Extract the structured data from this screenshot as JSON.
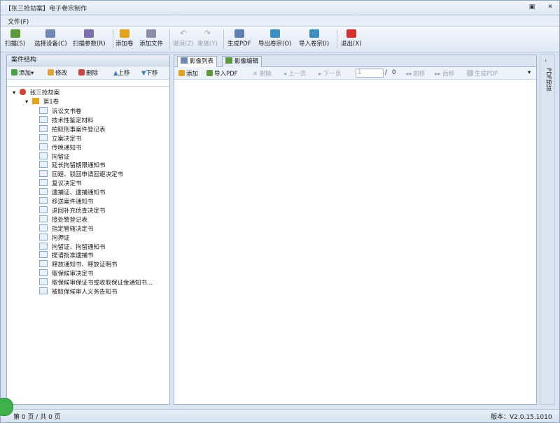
{
  "window": {
    "title": "【张三抢劫案】电子卷宗制作"
  },
  "menu": {
    "file": "文件(F)"
  },
  "toolbar": {
    "scan": "扫描(S)",
    "select_device": "选择设备(C)",
    "scan_params": "扫描参数(R)",
    "add_volume": "添加卷",
    "add_file": "添加文件",
    "undo": "撤消(Z)",
    "redo": "重做(Y)",
    "generate_pdf": "生成PDF",
    "export_volume": "导出卷宗(O)",
    "import_volume": "导入卷宗(I)",
    "exit": "退出(X)"
  },
  "left_panel": {
    "title": "案件结构",
    "tools": {
      "add": "添加",
      "edit": "修改",
      "delete": "删除",
      "up": "上移",
      "down": "下移"
    },
    "tree": {
      "root": "张三抢劫案",
      "volume": "第1卷",
      "docs": [
        "诉讼文书卷",
        "技术性鉴定材料",
        "拍取刑事案件登记表",
        "立案决定书",
        "传唤通知书",
        "拘留证",
        "延长拘留期限通知书",
        "回避、驳回申请回避决定书",
        "复议决定书",
        "逮捕证、逮捕通知书",
        "移送案件通知书",
        "退回补充侦查决定书",
        "接处警登记表",
        "指定管辖决定书",
        "拘押证",
        "拘留证、拘留通知书",
        "提请批准逮捕书",
        "释放通知书、释放证明书",
        "取保候审决定书",
        "取保候审保证书或收取保证金通知书...",
        "被取保候审人义务告知书"
      ]
    }
  },
  "right_panel": {
    "tabs": [
      "影像列表",
      "影像编辑"
    ],
    "tools": {
      "add": "添加",
      "import_pdf": "导入PDF",
      "delete": "删除",
      "prev": "上一页",
      "next": "下一页",
      "page_value": "1",
      "page_sep": "/",
      "page_total": "0",
      "move_prev": "前移",
      "move_next": "后移",
      "gen_pdf": "生成PDF"
    }
  },
  "side_strip": {
    "label": "PDF预览"
  },
  "status": {
    "pages": "第 0 页 / 共 0 页",
    "version": "版本：V2.0.15.1010"
  }
}
